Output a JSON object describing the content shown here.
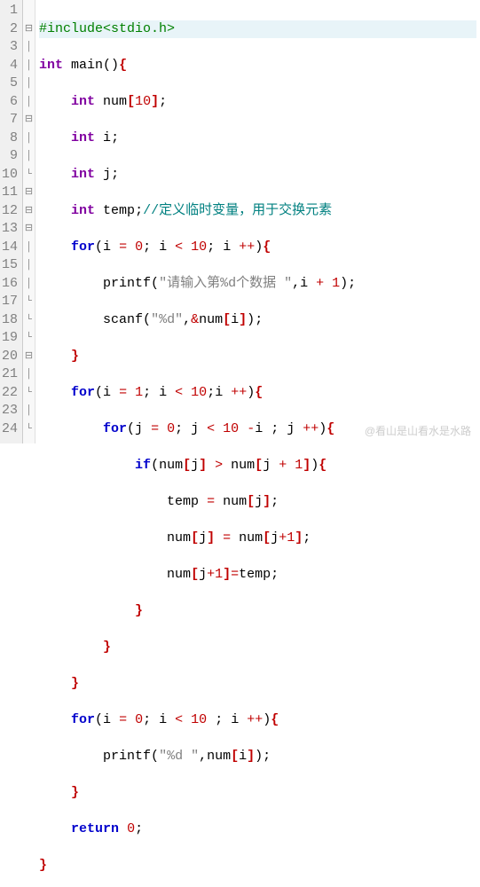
{
  "watermark": "@看山是山看水是水路",
  "lines": [
    {
      "n": 1,
      "fold": "",
      "hl": true
    },
    {
      "n": 2,
      "fold": "⊟",
      "hl": false
    },
    {
      "n": 3,
      "fold": "│",
      "hl": false
    },
    {
      "n": 4,
      "fold": "│",
      "hl": false
    },
    {
      "n": 5,
      "fold": "│",
      "hl": false
    },
    {
      "n": 6,
      "fold": "│",
      "hl": false
    },
    {
      "n": 7,
      "fold": "⊟",
      "hl": false
    },
    {
      "n": 8,
      "fold": "│",
      "hl": false
    },
    {
      "n": 9,
      "fold": "│",
      "hl": false
    },
    {
      "n": 10,
      "fold": "└",
      "hl": false
    },
    {
      "n": 11,
      "fold": "⊟",
      "hl": false
    },
    {
      "n": 12,
      "fold": "⊟",
      "hl": false
    },
    {
      "n": 13,
      "fold": "⊟",
      "hl": false
    },
    {
      "n": 14,
      "fold": "│",
      "hl": false
    },
    {
      "n": 15,
      "fold": "│",
      "hl": false
    },
    {
      "n": 16,
      "fold": "│",
      "hl": false
    },
    {
      "n": 17,
      "fold": "└",
      "hl": false
    },
    {
      "n": 18,
      "fold": "└",
      "hl": false
    },
    {
      "n": 19,
      "fold": "└",
      "hl": false
    },
    {
      "n": 20,
      "fold": "⊟",
      "hl": false
    },
    {
      "n": 21,
      "fold": "│",
      "hl": false
    },
    {
      "n": 22,
      "fold": "└",
      "hl": false
    },
    {
      "n": 23,
      "fold": "│",
      "hl": false
    },
    {
      "n": 24,
      "fold": "└",
      "hl": false
    }
  ],
  "code": {
    "l1": {
      "include": "#include",
      "hdr": "<stdio.h>"
    },
    "l2": {
      "kw1": "int",
      "fn": " main",
      "rest": "()",
      "br": "{"
    },
    "l3": {
      "pad": "    ",
      "kw": "int",
      "rest": " num",
      "br1": "[",
      "num": "10",
      "br2": "]",
      "semi": ";"
    },
    "l4": {
      "pad": "    ",
      "kw": "int",
      "rest": " i",
      "semi": ";"
    },
    "l5": {
      "pad": "    ",
      "kw": "int",
      "rest": " j",
      "semi": ";"
    },
    "l6": {
      "pad": "    ",
      "kw": "int",
      "rest": " temp",
      "semi": ";",
      "cmt": "//定义临时变量，用于交换元素"
    },
    "l7": {
      "pad": "    ",
      "kw": "for",
      "p1": "(i ",
      "op1": "=",
      "sp1": " ",
      "n1": "0",
      "sc1": ";",
      "mid": " i ",
      "op2": "<",
      "sp2": " ",
      "n2": "10",
      "sc2": ";",
      "end": " i ",
      "op3": "++",
      "p2": ")",
      "br": "{"
    },
    "l8": {
      "pad": "        ",
      "fn": "printf",
      "p1": "(",
      "str": "\"请输入第%d个数据 \"",
      "c": ",",
      "arg": "i ",
      "op": "+",
      "sp": " ",
      "n": "1",
      "p2": ")",
      "semi": ";"
    },
    "l9": {
      "pad": "        ",
      "fn": "scanf",
      "p1": "(",
      "str": "\"%d\"",
      "c": ",",
      "amp": "&",
      "id": "num",
      "br1": "[",
      "idx": "i",
      "br2": "]",
      "p2": ")",
      "semi": ";"
    },
    "l10": {
      "pad": "    ",
      "br": "}"
    },
    "l11": {
      "pad": "    ",
      "kw": "for",
      "p1": "(i ",
      "op1": "=",
      "sp1": " ",
      "n1": "1",
      "sc1": ";",
      "mid": " i ",
      "op2": "<",
      "sp2": " ",
      "n2": "10",
      "sc2": ";",
      "end": "i ",
      "op3": "++",
      "p2": ")",
      "br": "{"
    },
    "l12": {
      "pad": "        ",
      "kw": "for",
      "p1": "(j ",
      "op1": "=",
      "sp1": " ",
      "n1": "0",
      "sc1": ";",
      "mid": " j ",
      "op2": "<",
      "sp2": " ",
      "n2": "10",
      "sp3": " ",
      "op4": "-",
      "end2": "i ",
      "sc2": ";",
      "end": " j ",
      "op3": "++",
      "p2": ")",
      "br": "{"
    },
    "l13": {
      "pad": "            ",
      "kw": "if",
      "p1": "(num",
      "br1": "[",
      "j1": "j",
      "br2": "]",
      "sp": " ",
      "op": ">",
      "sp2": " num",
      "br3": "[",
      "j2": "j ",
      "op2": "+",
      "sp3": " ",
      "n": "1",
      "br4": "]",
      "p2": ")",
      "br": "{"
    },
    "l14": {
      "pad": "                ",
      "lhs": "temp ",
      "op": "=",
      "rhs": " num",
      "br1": "[",
      "idx": "j",
      "br2": "]",
      "semi": ";"
    },
    "l15": {
      "pad": "                ",
      "lhs": "num",
      "br1": "[",
      "i1": "j",
      "br2": "]",
      "sp": " ",
      "op": "=",
      "rhs": " num",
      "br3": "[",
      "i2": "j",
      "op2": "+",
      "n": "1",
      "br4": "]",
      "semi": ";"
    },
    "l16": {
      "pad": "                ",
      "lhs": "num",
      "br1": "[",
      "i1": "j",
      "op1": "+",
      "n": "1",
      "br2": "]",
      "op": "=",
      "rhs": "temp",
      "semi": ";"
    },
    "l17": {
      "pad": "            ",
      "br": "}"
    },
    "l18": {
      "pad": "        ",
      "br": "}"
    },
    "l19": {
      "pad": "    ",
      "br": "}"
    },
    "l20": {
      "pad": "    ",
      "kw": "for",
      "p1": "(i ",
      "op1": "=",
      "sp1": " ",
      "n1": "0",
      "sc1": ";",
      "mid": " i ",
      "op2": "<",
      "sp2": " ",
      "n2": "10",
      "sp3": " ",
      "sc2": ";",
      "end": " i ",
      "op3": "++",
      "p2": ")",
      "br": "{"
    },
    "l21": {
      "pad": "        ",
      "fn": "printf",
      "p1": "(",
      "str": "\"%d \"",
      "c": ",",
      "id": "num",
      "br1": "[",
      "idx": "i",
      "br2": "]",
      "p2": ")",
      "semi": ";"
    },
    "l22": {
      "pad": "    ",
      "br": "}"
    },
    "l23": {
      "pad": "    ",
      "kw": "return",
      "sp": " ",
      "n": "0",
      "semi": ";"
    },
    "l24": {
      "br": "}"
    }
  }
}
